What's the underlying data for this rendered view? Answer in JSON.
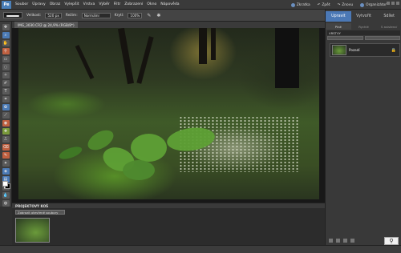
{
  "menubar": {
    "logo": "Pe",
    "items": [
      "Soubor",
      "Úpravy",
      "Obraz",
      "Vylepšit",
      "Vrstva",
      "Výběr",
      "Filtr",
      "Zobrazení",
      "Okno",
      "Nápověda"
    ],
    "right": [
      "Zkratka",
      "Zpět",
      "Znovu",
      "Organizátor"
    ]
  },
  "options": {
    "size_label": "Velikost:",
    "size_value": "520 px",
    "mode_label": "Režim:",
    "mode_value": "Normální",
    "opacity_label": "Krytí:",
    "opacity_value": "100%"
  },
  "document": {
    "tab_label": "IMG_3030.CR2 @ 24,9% (RGB/8*)"
  },
  "bin": {
    "title": "PROJEKTOVÝ KOŠ",
    "dropdown": "Zobrazit otevřené soubory"
  },
  "panel": {
    "tabs": [
      "Upravit",
      "Vytvořit",
      "Sdílet"
    ],
    "subtabs": [
      "Plné",
      "Rychlé",
      "S asistencí"
    ],
    "layers_header": "VRSTVY",
    "layer_name": "Pozadí",
    "lock_icon": "lock-icon",
    "zoom_icon": "magnifier-icon"
  },
  "colors": {
    "accent": "#4b78b5",
    "panel": "#393939",
    "foreground_swatch": "#ffffff",
    "background_swatch": "#000000"
  }
}
